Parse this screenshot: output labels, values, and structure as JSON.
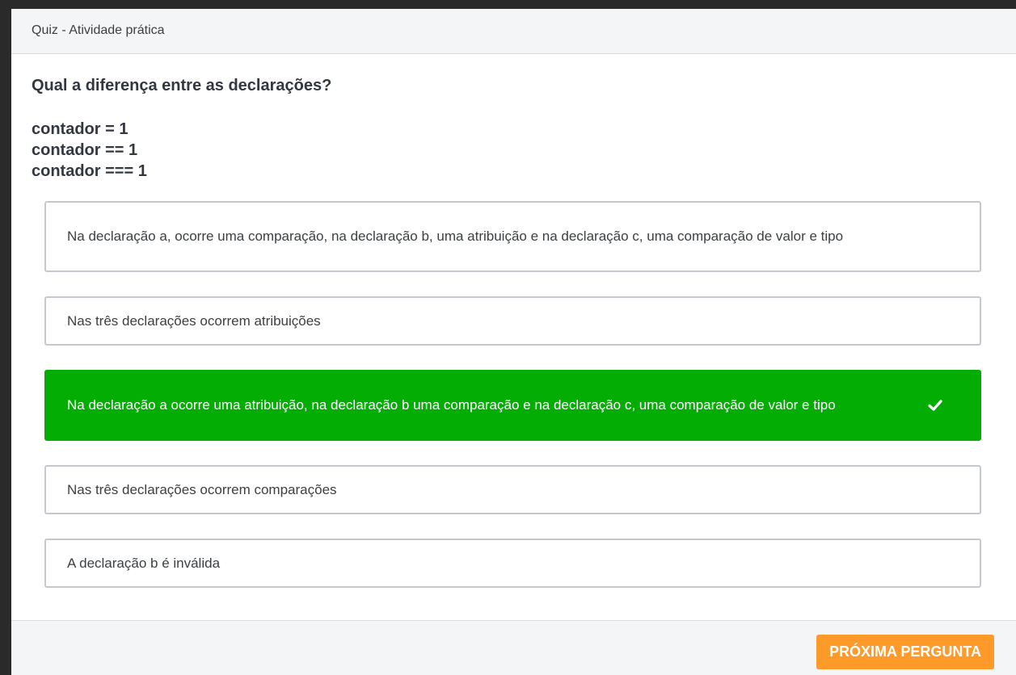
{
  "modal": {
    "title": "Quiz - Atividade prática"
  },
  "question": {
    "text": "Qual a diferença entre as declarações?",
    "code_lines": [
      "contador = 1",
      "contador == 1",
      "contador === 1"
    ]
  },
  "options": [
    {
      "label": "Na declaração a, ocorre uma comparação, na declaração b, uma atribuição e na declaração c, uma comparação de valor e tipo",
      "state": "default"
    },
    {
      "label": "Nas três declarações ocorrem atribuições",
      "state": "default"
    },
    {
      "label": "Na declaração a ocorre uma atribuição, na declaração b uma comparação e na declaração c, uma comparação de valor e tipo",
      "state": "correct",
      "icon": "check-icon"
    },
    {
      "label": "Nas três declarações ocorrem comparações",
      "state": "default"
    },
    {
      "label": "A declaração b é inválida",
      "state": "default"
    }
  ],
  "footer": {
    "next_label": "PRÓXIMA PERGUNTA"
  },
  "colors": {
    "correct": "#03ad03",
    "accent": "#fd9a29",
    "border": "#c5c9ce"
  }
}
